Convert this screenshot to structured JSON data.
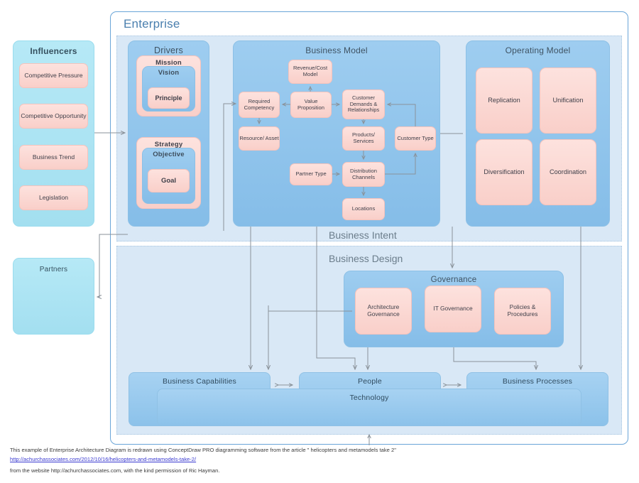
{
  "enterprise": {
    "title": "Enterprise"
  },
  "regions": {
    "intent": "Business Intent",
    "design": "Business Design"
  },
  "influencers": {
    "title": "Influencers",
    "items": [
      "Competitive Pressure",
      "Competitive Opportunity",
      "Business Trend",
      "Legislation"
    ]
  },
  "partners": {
    "title": "Partners"
  },
  "drivers": {
    "title": "Drivers",
    "mission": "Mission",
    "vision": "Vision",
    "principle": "Principle",
    "strategy": "Strategy",
    "objective": "Objective",
    "goal": "Goal"
  },
  "business_model": {
    "title": "Business Model",
    "nodes": {
      "revenue_cost": "Revenue/Cost Model",
      "required_competency": "Required Competency",
      "value_proposition": "Value Proposition",
      "customer_demands": "Customer Demands & Relationships",
      "resource_asset": "Resource/ Asset",
      "products_services": "Products/ Services",
      "customer_type": "Customer Type",
      "partner_type": "Partner Type",
      "distribution_channels": "Distribution Channels",
      "locations": "Locations"
    }
  },
  "operating_model": {
    "title": "Operating Model",
    "items": [
      "Replication",
      "Unification",
      "Diversification",
      "Coordination"
    ]
  },
  "governance": {
    "title": "Governance",
    "items": [
      "Architecture Governance",
      "IT Governance",
      "Policies & Procedures"
    ]
  },
  "foundation": {
    "capabilities": "Business Capabilities",
    "people": "People",
    "processes": "Business Processes",
    "technology": "Technology"
  },
  "footer": {
    "line1": "This example of Enterprise Architecture Diagram is redrawn using ConceptDraw PRO diagramming software  from the article \" helicopters and metamodels take 2\"",
    "link": "http://achurchassociates.com/2012/10/16/helicopters-and-metamodels-take-2/",
    "line3": "from the website http://achurchassociates.com,  with the kind permission of Ric Hayman."
  },
  "colors": {
    "pink": "#fad4ce",
    "mid_blue": "#8fc3eb",
    "light_blue": "#d9e8f6",
    "cyan": "#a8e4f2",
    "frame_blue": "#6aa5d8",
    "connector": "#8a929a"
  }
}
